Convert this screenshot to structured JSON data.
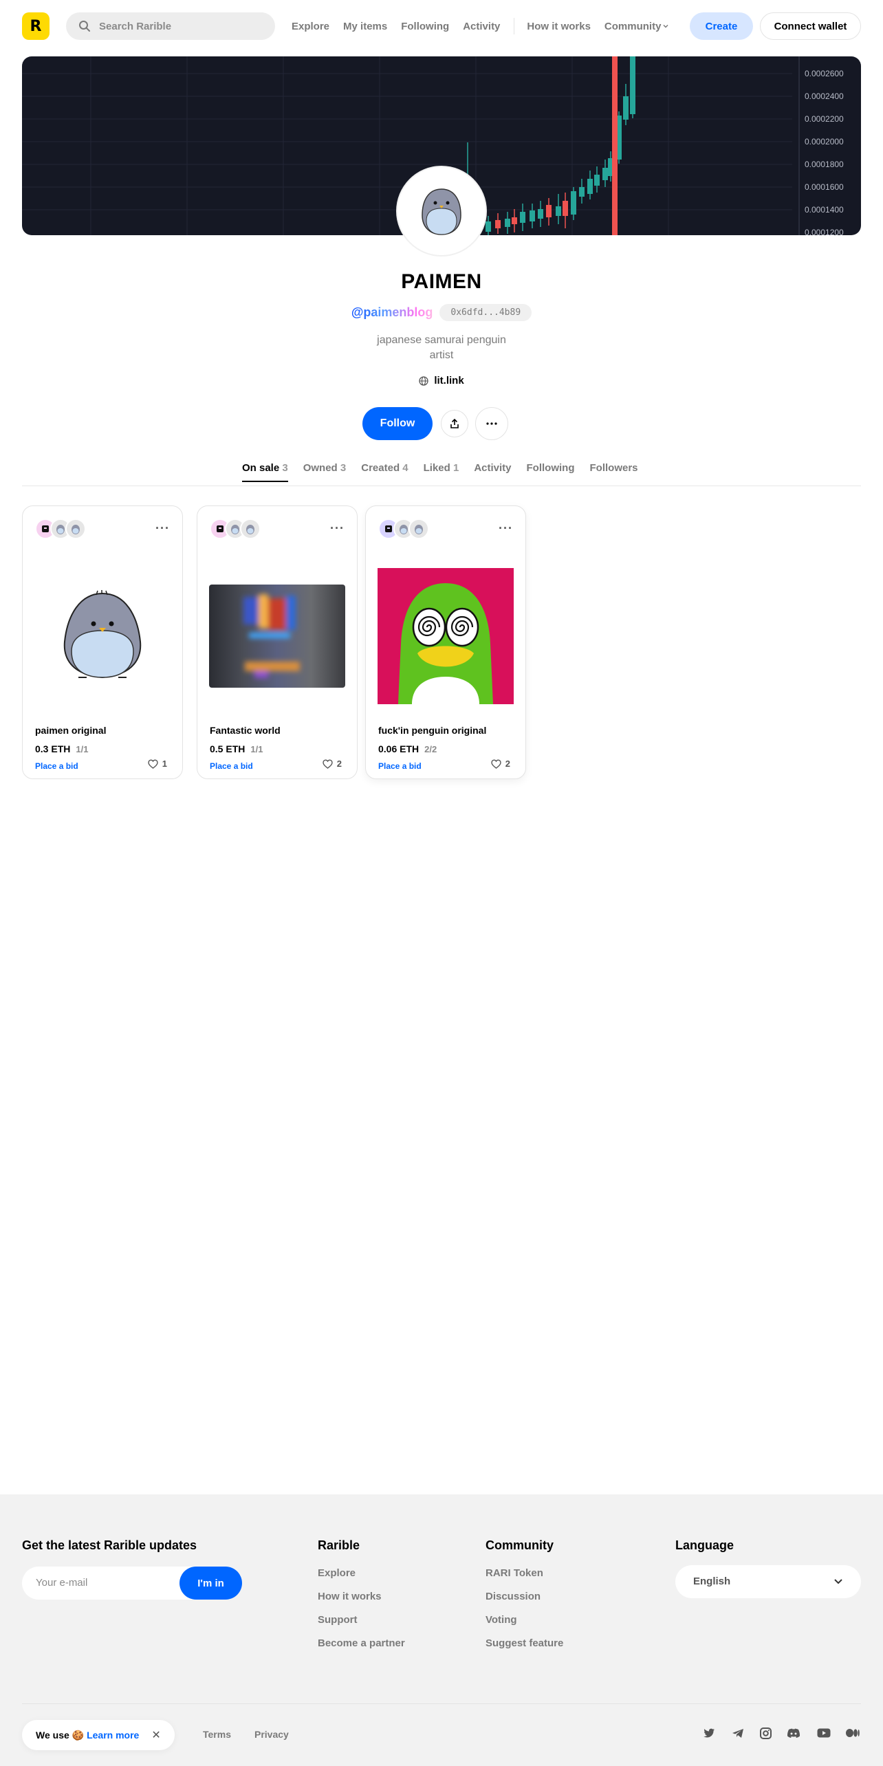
{
  "header": {
    "logo_letter": "R",
    "search_placeholder": "Search Rarible",
    "nav": [
      "Explore",
      "My items",
      "Following",
      "Activity",
      "How it works",
      "Community"
    ],
    "create_label": "Create",
    "wallet_label": "Connect wallet"
  },
  "cover": {
    "price_axis": [
      "0.0002600",
      "0.0002400",
      "0.0002200",
      "0.0002000",
      "0.0001800",
      "0.0001600",
      "0.0001400",
      "0.0001200"
    ]
  },
  "profile": {
    "name": "PAIMEN",
    "handle": "@paimenblog",
    "address": "0x6dfd...4b89",
    "bio_line1": "japanese samurai penguin",
    "bio_line2": "artist",
    "link": "lit.link",
    "follow_label": "Follow"
  },
  "tabs": [
    {
      "label": "On sale",
      "count": "3"
    },
    {
      "label": "Owned",
      "count": "3"
    },
    {
      "label": "Created",
      "count": "4"
    },
    {
      "label": "Liked",
      "count": "1"
    },
    {
      "label": "Activity",
      "count": ""
    },
    {
      "label": "Following",
      "count": ""
    },
    {
      "label": "Followers",
      "count": ""
    }
  ],
  "cards": [
    {
      "title": "paimen original",
      "price": "0.3 ETH",
      "edition": "1/1",
      "bid": "Place a bid",
      "likes": "1"
    },
    {
      "title": "Fantastic world",
      "price": "0.5 ETH",
      "edition": "1/1",
      "bid": "Place a bid",
      "likes": "2"
    },
    {
      "title": "fuck'in penguin original",
      "price": "0.06 ETH",
      "edition": "2/2",
      "bid": "Place a bid",
      "likes": "2"
    }
  ],
  "footer": {
    "updates_title": "Get the latest Rarible updates",
    "email_placeholder": "Your e-mail",
    "subscribe_label": "I'm in",
    "rarible_title": "Rarible",
    "rarible_links": [
      "Explore",
      "How it works",
      "Support",
      "Become a partner"
    ],
    "community_title": "Community",
    "community_links": [
      "RARI Token",
      "Discussion",
      "Voting",
      "Suggest feature"
    ],
    "language_title": "Language",
    "language_value": "English",
    "cookie_text": "We use 🍪",
    "cookie_link": "Learn more",
    "cookie_close": "✕",
    "terms": "Terms",
    "privacy": "Privacy",
    "social_icons": [
      "twitter-icon",
      "telegram-icon",
      "instagram-icon",
      "discord-icon",
      "youtube-icon",
      "medium-icon"
    ]
  },
  "colors": {
    "accent": "#0066ff",
    "logo": "#FEDA03",
    "chart_bg": "#151824",
    "candle_up": "#26a69a",
    "candle_down": "#ef5350"
  }
}
